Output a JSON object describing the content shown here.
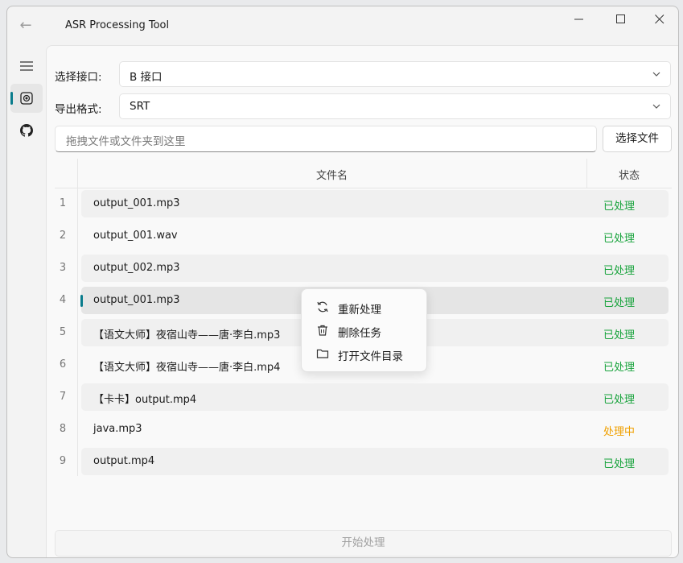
{
  "app": {
    "title": "ASR Processing Tool"
  },
  "form": {
    "api_label": "选择接口:",
    "api_value": "B 接口",
    "format_label": "导出格式:",
    "format_value": "SRT",
    "drop_placeholder": "拖拽文件或文件夹到这里",
    "pick_button": "选择文件"
  },
  "table": {
    "headers": {
      "name": "文件名",
      "status": "状态"
    },
    "rows": [
      {
        "num": "1",
        "name": "output_001.mp3",
        "status": "已处理"
      },
      {
        "num": "2",
        "name": "output_001.wav",
        "status": "已处理"
      },
      {
        "num": "3",
        "name": "output_002.mp3",
        "status": "已处理"
      },
      {
        "num": "4",
        "name": "output_001.mp3",
        "status": "已处理"
      },
      {
        "num": "5",
        "name": "【语文大师】夜宿山寺——唐·李白.mp3",
        "status": "已处理"
      },
      {
        "num": "6",
        "name": "【语文大师】夜宿山寺——唐·李白.mp4",
        "status": "已处理"
      },
      {
        "num": "7",
        "name": "【卡卡】output.mp4",
        "status": "已处理"
      },
      {
        "num": "8",
        "name": "java.mp3",
        "status": "处理中"
      },
      {
        "num": "9",
        "name": "output.mp4",
        "status": "已处理"
      }
    ]
  },
  "context_menu": {
    "items": [
      {
        "label": "重新处理",
        "icon": "refresh-icon"
      },
      {
        "label": "删除任务",
        "icon": "trash-icon"
      },
      {
        "label": "打开文件目录",
        "icon": "folder-icon"
      }
    ]
  },
  "footer": {
    "start_button": "开始处理"
  },
  "colors": {
    "accent": "#0a7c8c",
    "done": "#18a33c",
    "processing": "#f0a000"
  }
}
